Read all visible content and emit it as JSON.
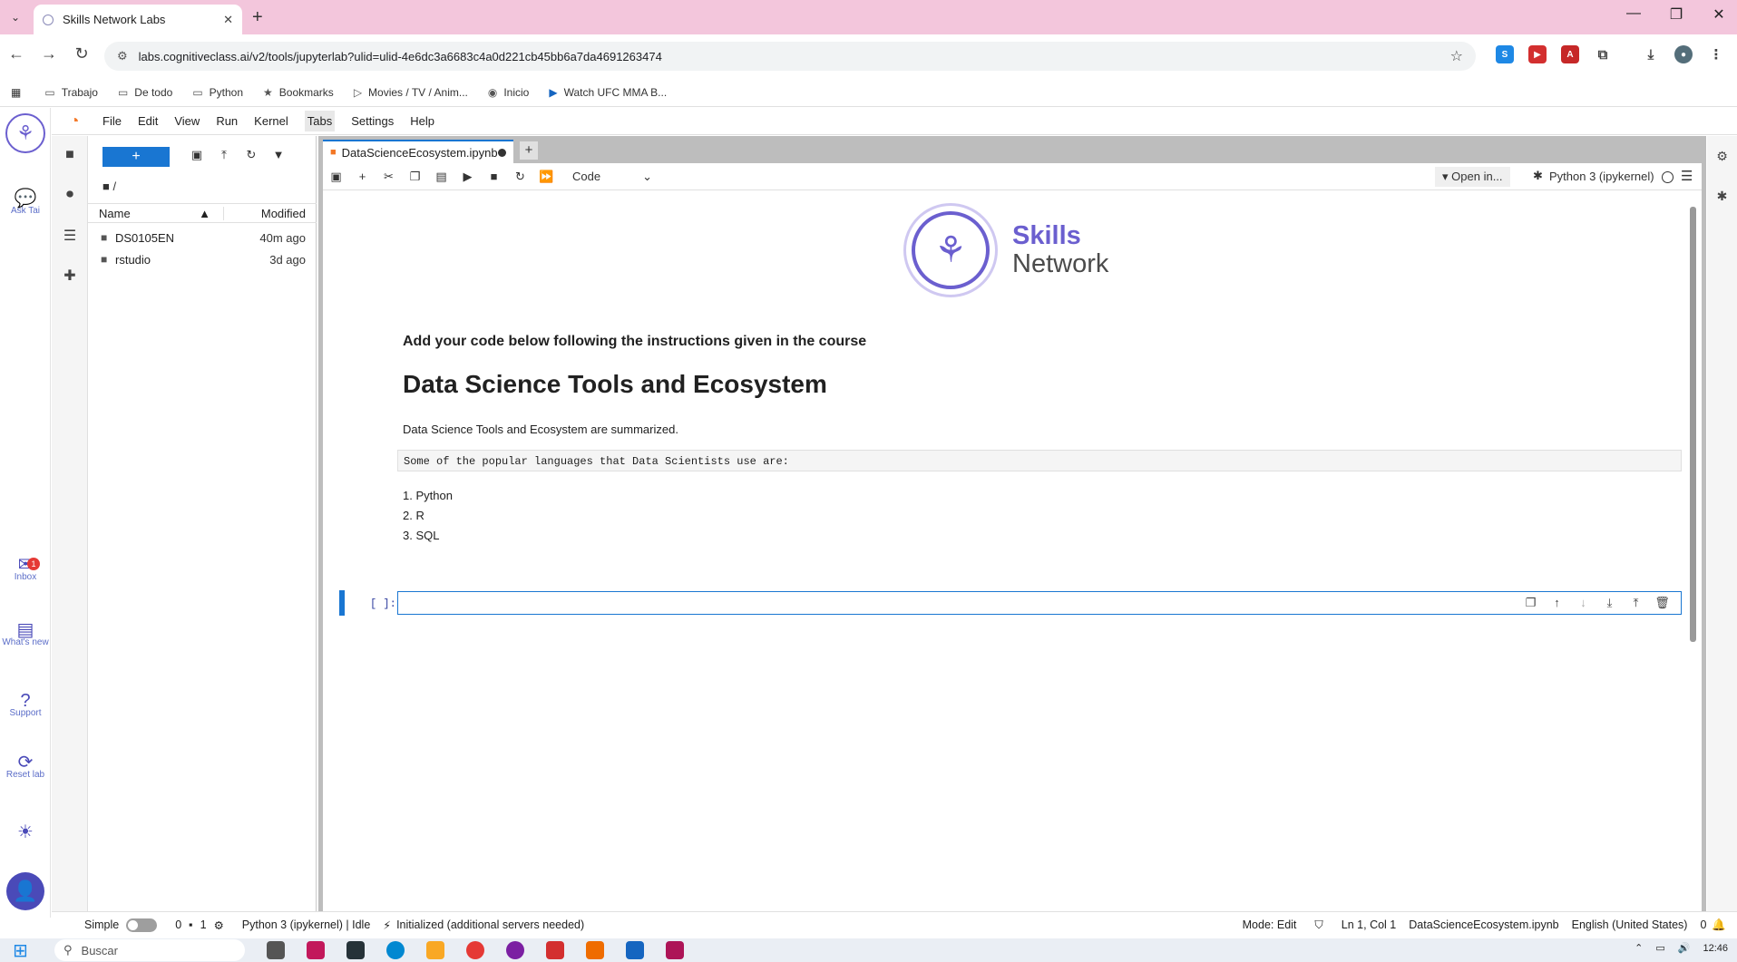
{
  "browser": {
    "tab_title": "Skills Network Labs",
    "url": "labs.cognitiveclass.ai/v2/tools/jupyterlab?ulid=ulid-4e6dc3a6683c4a0d221cb45bb6a7da4691263474",
    "bookmarks": [
      {
        "icon": "folder-icon",
        "label": "Trabajo"
      },
      {
        "icon": "folder-icon",
        "label": "De todo"
      },
      {
        "icon": "folder-icon",
        "label": "Python"
      },
      {
        "icon": "star-icon",
        "label": "Bookmarks"
      },
      {
        "icon": "play-outline-icon",
        "label": "Movies / TV / Anim..."
      },
      {
        "icon": "globe-icon",
        "label": "Inicio"
      },
      {
        "icon": "play-icon",
        "label": "Watch UFC MMA B..."
      }
    ]
  },
  "rail": {
    "ask_label": "Ask Tai",
    "inbox_label": "Inbox",
    "inbox_count": "1",
    "whats_new_label": "What's new",
    "support_label": "Support",
    "reset_label": "Reset lab"
  },
  "menubar": {
    "items": [
      "File",
      "Edit",
      "View",
      "Run",
      "Kernel",
      "Tabs",
      "Settings",
      "Help"
    ]
  },
  "filebrowser": {
    "new_label": "+",
    "path": "/",
    "col_name": "Name",
    "col_modified": "Modified",
    "files": [
      {
        "name": "DS0105EN",
        "modified": "40m ago"
      },
      {
        "name": "rstudio",
        "modified": "3d ago"
      }
    ]
  },
  "notebook": {
    "tab_title": "DataScienceEcosystem.ipynb",
    "cell_type": "Code",
    "open_in": "Open in...",
    "kernel": "Python 3 (ipykernel)",
    "logo_skills": "Skills",
    "logo_network": "Network",
    "instruction": "Add your code below following the instructions given in the course",
    "heading": "Data Science Tools and Ecosystem",
    "summary": "Data Science Tools and Ecosystem are summarized.",
    "code_text": "Some of the popular languages that Data Scientists use are:",
    "languages": [
      "1. Python",
      "2. R",
      "3. SQL"
    ],
    "prompt": "[ ]:",
    "input_value": ""
  },
  "statusbar": {
    "mode_label": "Simple",
    "terminals": "0",
    "kernels": "1",
    "kernel_state": "Python 3 (ipykernel) | Idle",
    "lsp": "Initialized (additional servers needed)",
    "mode": "Mode: Edit",
    "cursor": "Ln 1, Col 1",
    "file": "DataScienceEcosystem.ipynb",
    "language": "English (United States)",
    "notifications": "0"
  },
  "taskbar": {
    "search_placeholder": "Buscar",
    "time": "12:46"
  },
  "colors": {
    "tabstrip": "#f3c6dc",
    "accent": "#1976d2",
    "brand": "#6b5fcf"
  }
}
